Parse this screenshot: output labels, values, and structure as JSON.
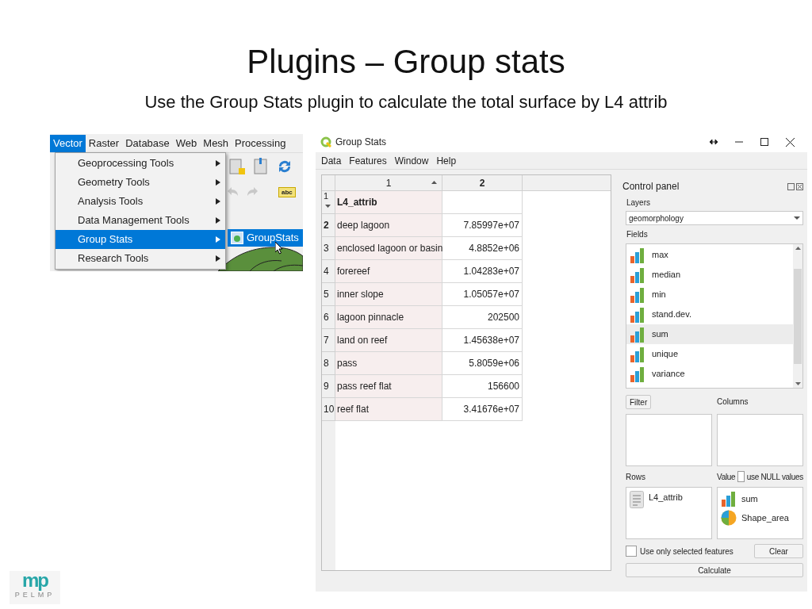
{
  "slide": {
    "title": "Plugins – Group stats",
    "subtitle": "Use the Group Stats plugin to calculate the total surface by L4 attrib"
  },
  "qgis_menu": {
    "menubar": [
      {
        "label": "Vector",
        "selected": true
      },
      {
        "label": "Raster",
        "selected": false
      },
      {
        "label": "Database",
        "selected": false
      },
      {
        "label": "Web",
        "selected": false
      },
      {
        "label": "Mesh",
        "selected": false
      },
      {
        "label": "Processing",
        "selected": false
      }
    ],
    "items": [
      {
        "label": "Geoprocessing Tools",
        "selected": false
      },
      {
        "label": "Geometry Tools",
        "selected": false
      },
      {
        "label": "Analysis Tools",
        "selected": false
      },
      {
        "label": "Data Management Tools",
        "selected": false
      },
      {
        "label": "Group Stats",
        "selected": true
      },
      {
        "label": "Research Tools",
        "selected": false
      }
    ],
    "submenu": {
      "label": "GroupStats"
    },
    "label_tool": "abc"
  },
  "window": {
    "title": "Group Stats",
    "menu": [
      "Data",
      "Features",
      "Window",
      "Help"
    ],
    "table": {
      "columns": [
        "1",
        "2"
      ],
      "rows": [
        {
          "number": "1",
          "cells": [
            "L4_attrib",
            ""
          ],
          "header": true,
          "current": false
        },
        {
          "number": "2",
          "cells": [
            "deep lagoon",
            "7.85997e+07"
          ],
          "header": false,
          "current": true
        },
        {
          "number": "3",
          "cells": [
            "enclosed lagoon or basin",
            "4.8852e+06"
          ],
          "header": false,
          "current": false
        },
        {
          "number": "4",
          "cells": [
            "forereef",
            "1.04283e+07"
          ],
          "header": false,
          "current": false
        },
        {
          "number": "5",
          "cells": [
            "inner slope",
            "1.05057e+07"
          ],
          "header": false,
          "current": false
        },
        {
          "number": "6",
          "cells": [
            "lagoon pinnacle",
            "202500"
          ],
          "header": false,
          "current": false
        },
        {
          "number": "7",
          "cells": [
            "land on reef",
            "1.45638e+07"
          ],
          "header": false,
          "current": false
        },
        {
          "number": "8",
          "cells": [
            "pass",
            "5.8059e+06"
          ],
          "header": false,
          "current": false
        },
        {
          "number": "9",
          "cells": [
            "pass reef flat",
            "156600"
          ],
          "header": false,
          "current": false
        },
        {
          "number": "10",
          "cells": [
            "reef flat",
            "3.41676e+07"
          ],
          "header": false,
          "current": false
        }
      ]
    },
    "control_panel": {
      "title": "Control panel",
      "layers_label": "Layers",
      "layer": "geomorphology",
      "fields_label": "Fields",
      "fields": [
        {
          "label": "max",
          "selected": false
        },
        {
          "label": "median",
          "selected": false
        },
        {
          "label": "min",
          "selected": false
        },
        {
          "label": "stand.dev.",
          "selected": false
        },
        {
          "label": "sum",
          "selected": true
        },
        {
          "label": "unique",
          "selected": false
        },
        {
          "label": "variance",
          "selected": false
        }
      ],
      "filter_button": "Filter",
      "columns_label": "Columns",
      "rows_label": "Rows",
      "value_label": "Value",
      "use_null": {
        "label": "use NULL values",
        "checked": false
      },
      "rows": [
        {
          "label": "L4_attrib",
          "kind": "text"
        }
      ],
      "values": [
        {
          "label": "sum",
          "kind": "function"
        },
        {
          "label": "Shape_area",
          "kind": "number"
        }
      ],
      "selected_only": {
        "label": "Use only selected features",
        "checked": false
      },
      "clear_button": "Clear",
      "calculate_button": "Calculate"
    }
  },
  "logo": {
    "mark": "mp",
    "caption": "PELMP"
  }
}
